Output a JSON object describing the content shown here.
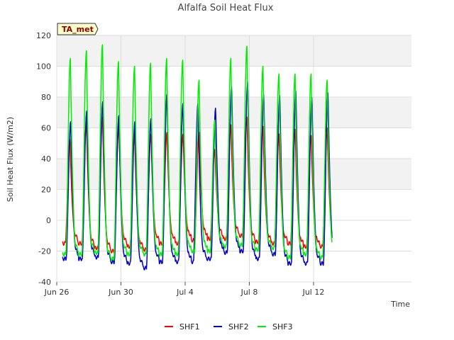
{
  "chart_data": {
    "type": "line",
    "title": "Alfalfa Soil Heat Flux",
    "xlabel": "Time",
    "ylabel": "Soil Heat Flux (W/m2)",
    "badge": "TA_met",
    "xlim": [
      0,
      22.1
    ],
    "ylim": [
      -40,
      120
    ],
    "yticks": [
      -40,
      -20,
      0,
      20,
      40,
      60,
      80,
      100,
      120
    ],
    "xticks": [
      {
        "day": 0,
        "label": "Jun 26"
      },
      {
        "day": 4,
        "label": "Jun 30"
      },
      {
        "day": 8,
        "label": "Jul 4"
      },
      {
        "day": 12,
        "label": "Jul 8"
      },
      {
        "day": 16,
        "label": "Jul 12"
      }
    ],
    "shaded_bands": [
      [
        20,
        40
      ],
      [
        60,
        80
      ],
      [
        100,
        120
      ]
    ],
    "grid": true,
    "legend_position": "bottom",
    "colors": {
      "SHF1": "#ff0000",
      "SHF2": "#0000cc",
      "SHF3": "#00ee00",
      "band": "#f2f2f2",
      "grid": "#dddddd"
    },
    "series": [
      {
        "name": "SHF1",
        "peak_day": [
          0.82,
          1.85,
          2.85,
          3.87,
          4.85,
          5.87,
          6.87,
          7.87,
          8.87,
          9.85,
          10.85,
          11.85,
          12.85,
          13.85,
          14.85,
          15.85,
          16.85
        ],
        "peaks": [
          53,
          64,
          67,
          61,
          56,
          56,
          57,
          56,
          57,
          46,
          62,
          67,
          61,
          56,
          59,
          55,
          60
        ],
        "troughs": [
          -15,
          -18,
          -20,
          -17,
          -19,
          -15,
          -15,
          -13,
          -12,
          -12,
          -10,
          -14,
          -15,
          -15,
          -17,
          -17,
          -15
        ]
      },
      {
        "name": "SHF2",
        "peak_day": [
          0.87,
          1.87,
          2.87,
          3.87,
          4.87,
          5.87,
          6.87,
          7.87,
          8.8,
          9.9,
          10.9,
          11.9,
          12.9,
          13.9,
          14.9,
          15.9,
          16.9
        ],
        "peaks": [
          64,
          71,
          77,
          68,
          64,
          66,
          82,
          76,
          76,
          73,
          87,
          90,
          82,
          81,
          84,
          80,
          83
        ],
        "troughs": [
          -25,
          -24,
          -27,
          -28,
          -31,
          -27,
          -27,
          -27,
          -25,
          -21,
          -20,
          -25,
          -22,
          -28,
          -28,
          -28,
          -24
        ]
      },
      {
        "name": "SHF3",
        "peak_day": [
          0.85,
          1.85,
          2.85,
          3.85,
          4.85,
          5.85,
          6.85,
          7.85,
          8.87,
          9.85,
          10.85,
          11.85,
          12.85,
          13.85,
          14.85,
          15.85,
          16.85
        ],
        "peaks": [
          105,
          110,
          114,
          103,
          100,
          102,
          105,
          104,
          91,
          65,
          105,
          113,
          100,
          95,
          95,
          95,
          91
        ],
        "troughs": [
          -22,
          -21,
          -25,
          -22,
          -22,
          -22,
          -22,
          -20,
          -20,
          -17,
          -16,
          -19,
          -18,
          -24,
          -22,
          -24,
          -21
        ]
      }
    ]
  }
}
